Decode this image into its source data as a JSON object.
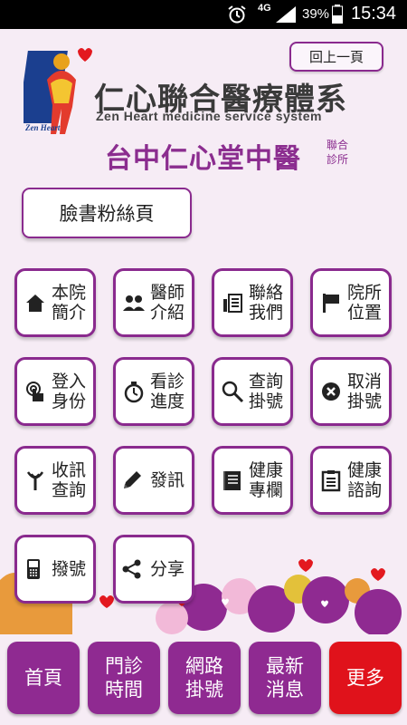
{
  "status_bar": {
    "network": "4G",
    "battery": "39%",
    "time": "15:34"
  },
  "header": {
    "back_label": "回上一頁",
    "brand_cn": "仁心聯合醫療體系",
    "brand_en": "Zen Heart medicine service system",
    "logo_text": "Zen Heart",
    "clinic_name": "台中仁心堂中醫",
    "clinic_suffix": "聯合診所"
  },
  "facebook_button": {
    "label": "臉書粉絲頁"
  },
  "menu": [
    {
      "label": "本院簡介",
      "icon": "home-icon"
    },
    {
      "label": "醫師介紹",
      "icon": "people-icon"
    },
    {
      "label": "聯絡我們",
      "icon": "contact-icon"
    },
    {
      "label": "院所位置",
      "icon": "flag-icon"
    },
    {
      "label": "登入身份",
      "icon": "touch-icon"
    },
    {
      "label": "看診進度",
      "icon": "stopwatch-icon"
    },
    {
      "label": "查詢掛號",
      "icon": "search-icon"
    },
    {
      "label": "取消掛號",
      "icon": "cancel-icon"
    },
    {
      "label": "收訊查詢",
      "icon": "antenna-icon"
    },
    {
      "label": "發訊",
      "icon": "pencil-icon"
    },
    {
      "label": "健康專欄",
      "icon": "notebook-icon"
    },
    {
      "label": "健康諮詢",
      "icon": "clipboard-icon"
    },
    {
      "label": "撥號",
      "icon": "phone-icon"
    },
    {
      "label": "分享",
      "icon": "share-icon"
    }
  ],
  "bottom_nav": [
    {
      "label": "首頁"
    },
    {
      "label": "門診時間"
    },
    {
      "label": "網路掛號"
    },
    {
      "label": "最新消息"
    },
    {
      "label": "更多"
    }
  ],
  "colors": {
    "accent": "#8a2a8e",
    "more": "#e0121b",
    "background": "#f6ecf5"
  }
}
